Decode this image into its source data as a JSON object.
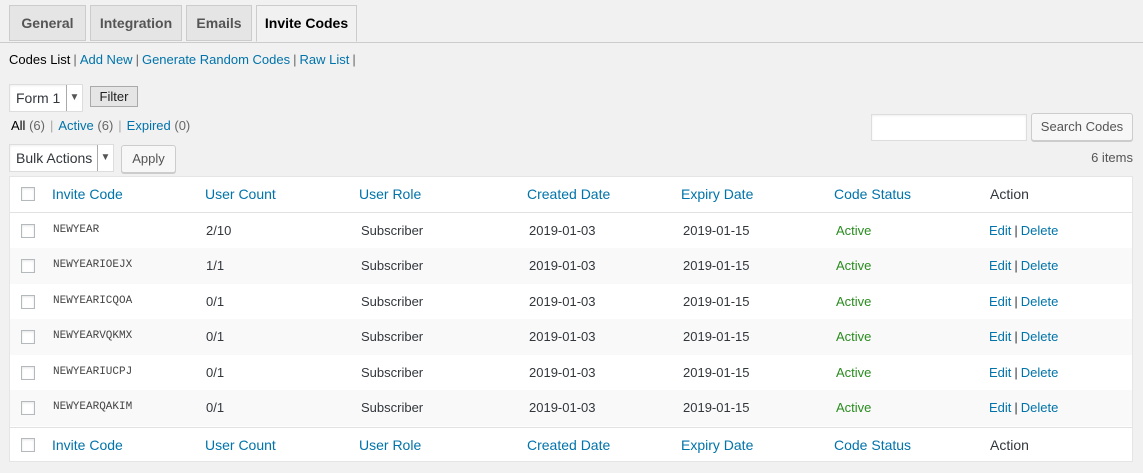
{
  "tabs": [
    "General",
    "Integration",
    "Emails",
    "Invite Codes"
  ],
  "subnav": {
    "codes_list": "Codes List",
    "add_new": "Add New",
    "generate_random": "Generate Random Codes",
    "raw_list": "Raw List"
  },
  "form_select": {
    "value": "Form 1"
  },
  "filter_button": "Filter",
  "filters": {
    "all": "All",
    "all_count": "(6)",
    "active": "Active",
    "active_count": "(6)",
    "expired": "Expired",
    "expired_count": "(0)"
  },
  "search": {
    "placeholder": "",
    "button": "Search Codes"
  },
  "bulk_actions": {
    "value": "Bulk Actions",
    "apply": "Apply"
  },
  "items_count": "6 items",
  "columns": [
    "Invite Code",
    "User Count",
    "User Role",
    "Created Date",
    "Expiry Date",
    "Code Status",
    "Action"
  ],
  "rows": [
    {
      "code": "NEWYEAR",
      "count": "2/10",
      "role": "Subscriber",
      "created": "2019-01-03",
      "expiry": "2019-01-15",
      "status": "Active",
      "edit": "Edit",
      "delete": "Delete"
    },
    {
      "code": "NEWYEARIOEJX",
      "count": "1/1",
      "role": "Subscriber",
      "created": "2019-01-03",
      "expiry": "2019-01-15",
      "status": "Active",
      "edit": "Edit",
      "delete": "Delete"
    },
    {
      "code": "NEWYEARICQOA",
      "count": "0/1",
      "role": "Subscriber",
      "created": "2019-01-03",
      "expiry": "2019-01-15",
      "status": "Active",
      "edit": "Edit",
      "delete": "Delete"
    },
    {
      "code": "NEWYEARVQKMX",
      "count": "0/1",
      "role": "Subscriber",
      "created": "2019-01-03",
      "expiry": "2019-01-15",
      "status": "Active",
      "edit": "Edit",
      "delete": "Delete"
    },
    {
      "code": "NEWYEARIUCPJ",
      "count": "0/1",
      "role": "Subscriber",
      "created": "2019-01-03",
      "expiry": "2019-01-15",
      "status": "Active",
      "edit": "Edit",
      "delete": "Delete"
    },
    {
      "code": "NEWYEARQAKIM",
      "count": "0/1",
      "role": "Subscriber",
      "created": "2019-01-03",
      "expiry": "2019-01-15",
      "status": "Active",
      "edit": "Edit",
      "delete": "Delete"
    }
  ],
  "colors": {
    "link": "#0073aa",
    "active_status": "#2a8c1f",
    "background": "#f1f1f1"
  }
}
